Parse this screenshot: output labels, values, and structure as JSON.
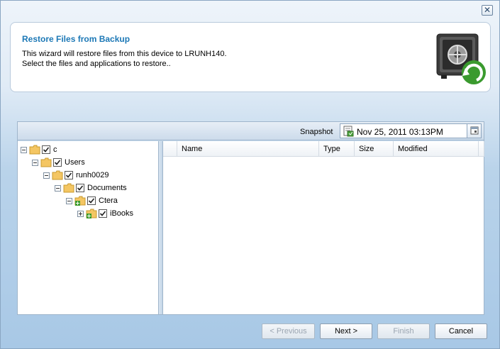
{
  "window": {
    "close_glyph": "✕"
  },
  "header": {
    "title": "Restore Files from Backup",
    "description_line1": "This wizard will restore files from this device to LRUNH140.",
    "description_line2": "Select the files and applications to restore..",
    "icon": "safe-restore-icon"
  },
  "snapshot": {
    "label": "Snapshot",
    "value": "Nov 25, 2011 03:13PM",
    "icon": "snapshot-icon",
    "picker_icon": "calendar-icon"
  },
  "tree": {
    "items": [
      {
        "label": "c",
        "expander": "minus",
        "checked": true
      },
      {
        "label": "Users",
        "expander": "minus",
        "checked": true
      },
      {
        "label": "runh0029",
        "expander": "minus",
        "checked": true
      },
      {
        "label": "Documents",
        "expander": "minus",
        "checked": true
      },
      {
        "label": "Ctera",
        "expander": "minus",
        "checked": true
      },
      {
        "label": "iBooks",
        "expander": "plus",
        "checked": true
      }
    ]
  },
  "files": {
    "columns": [
      "Name",
      "Type",
      "Size",
      "Modified"
    ]
  },
  "buttons": {
    "previous": "< Previous",
    "next": "Next >",
    "finish": "Finish",
    "cancel": "Cancel"
  },
  "colors": {
    "title": "#1c78b6",
    "folder": "#f4c663",
    "background": "#b9d3ea"
  }
}
